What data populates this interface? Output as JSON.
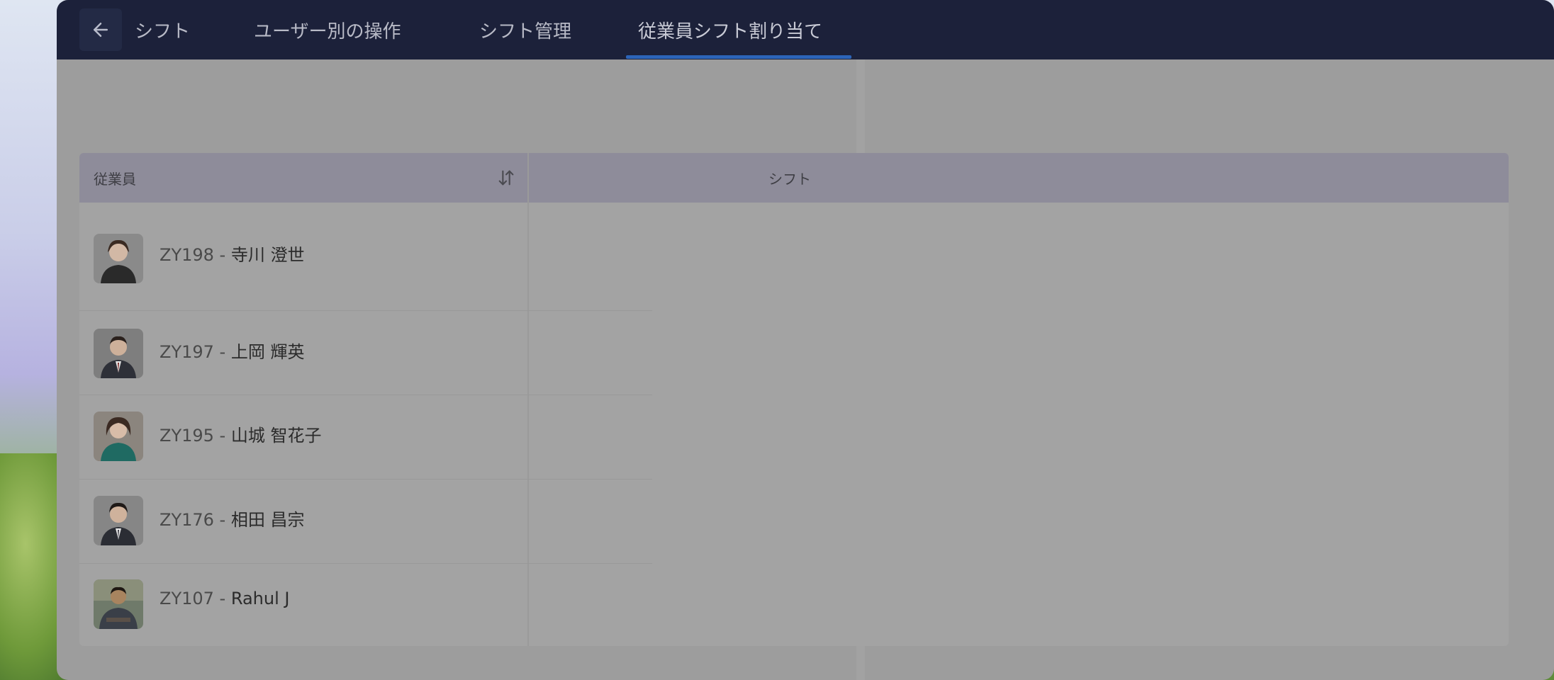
{
  "header": {
    "tabs": [
      {
        "label": "シフト"
      },
      {
        "label": "ユーザー別の操作"
      },
      {
        "label": "シフト管理"
      },
      {
        "label": "従業員シフト割り当て",
        "active": true
      }
    ]
  },
  "table": {
    "columns": [
      "従業員",
      "シフト"
    ],
    "rows": [
      {
        "id": "ZY198 - ",
        "name": "寺川 澄世"
      },
      {
        "id": "ZY197 - ",
        "name": "上岡 輝英"
      },
      {
        "id": "ZY195 - ",
        "name": "山城 智花子"
      },
      {
        "id": "ZY176 - ",
        "name": "相田 昌宗"
      },
      {
        "id": "ZY107 - ",
        "name": "Rahul J"
      }
    ]
  },
  "colors": {
    "header_bg": "#1c213a",
    "active_tab_underline": "#2c64b8",
    "overlay_bg": "#9d9d9d",
    "table_header_bg": "#8e8c9a"
  },
  "icons": {
    "back": "arrow-left-icon",
    "sort": "sort-icon"
  }
}
